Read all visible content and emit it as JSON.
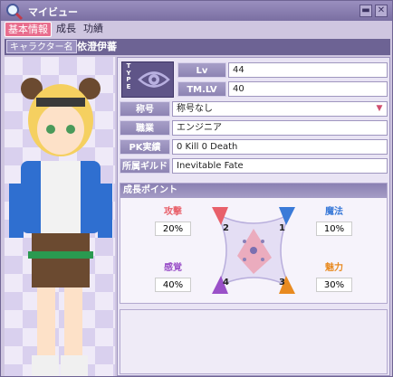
{
  "window": {
    "title": "マイビュー",
    "minimize_glyph": "▬",
    "close_glyph": "✕"
  },
  "tabs": [
    {
      "label": "基本情報",
      "active": true
    },
    {
      "label": "成長",
      "active": false
    },
    {
      "label": "功績",
      "active": false
    }
  ],
  "character": {
    "name_label": "キャラクター名",
    "name": "依澄伊蕃"
  },
  "type": {
    "letters": [
      "T",
      "Y",
      "P",
      "E"
    ],
    "icon": "eye-icon"
  },
  "stats": {
    "lv": {
      "label": "Lv",
      "value": "44"
    },
    "tmlv": {
      "label": "TM.LV",
      "value": "40"
    },
    "title": {
      "label": "称号",
      "value": "称号なし"
    },
    "job": {
      "label": "職業",
      "value": "エンジニア"
    },
    "pk": {
      "label": "PK実績",
      "value": "0 Kill  0 Death"
    },
    "guild": {
      "label": "所属ギルド",
      "value": "Inevitable Fate"
    }
  },
  "growth": {
    "header": "成長ポイント",
    "attack": {
      "label": "攻撃",
      "value": "20%",
      "color": "#e8606a"
    },
    "magic": {
      "label": "魔法",
      "value": "10%",
      "color": "#3a7ad8"
    },
    "sense": {
      "label": "感覚",
      "value": "40%",
      "color": "#9a50c8"
    },
    "charm": {
      "label": "魅力",
      "value": "30%",
      "color": "#e88a20"
    },
    "slot_numbers": [
      "2",
      "1",
      "4",
      "3"
    ]
  }
}
